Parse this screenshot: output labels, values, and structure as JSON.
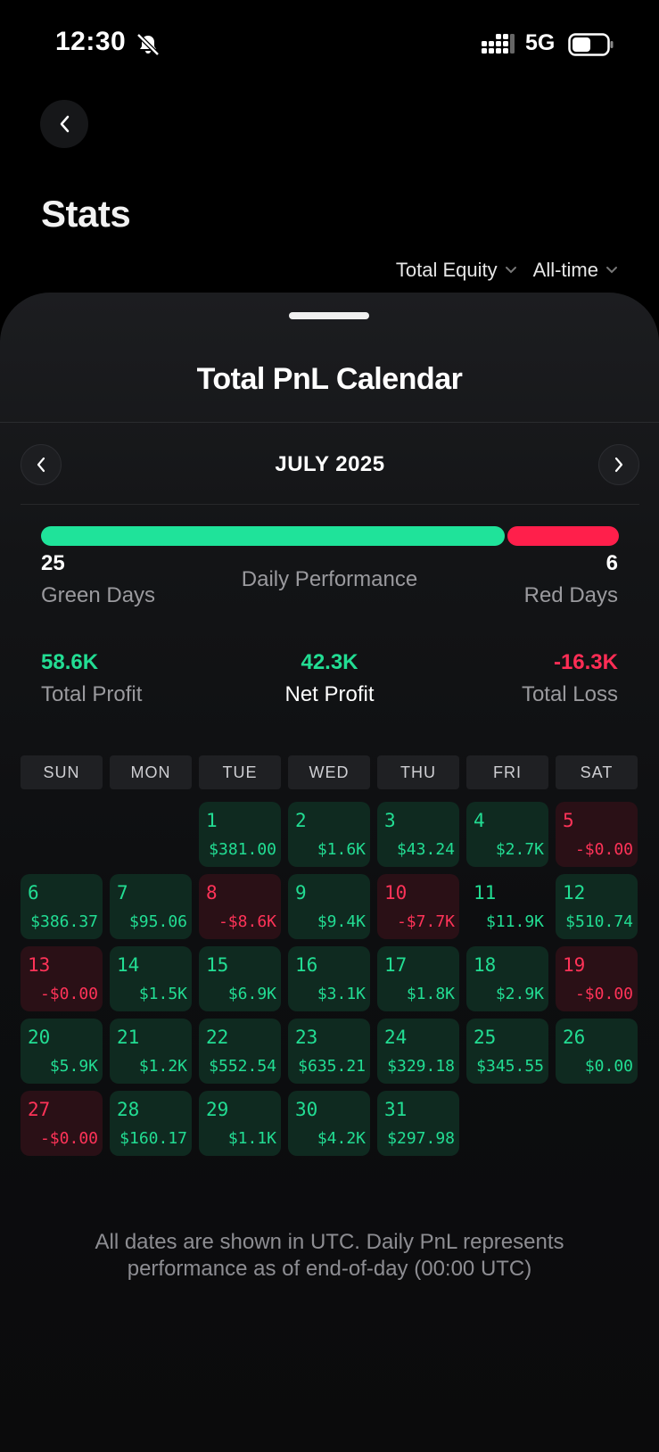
{
  "status_bar": {
    "time": "12:30",
    "network": "5G"
  },
  "header": {
    "title": "Stats"
  },
  "filters": [
    {
      "label": "Total Equity"
    },
    {
      "label": "All-time"
    }
  ],
  "calendar_sheet": {
    "title": "Total PnL Calendar",
    "month": "JULY 2025",
    "performance": {
      "green_count": "25",
      "green_label": "Green Days",
      "center_label": "Daily Performance",
      "red_count": "6",
      "red_label": "Red Days",
      "green_fraction": 0.8065
    },
    "totals": {
      "profit_value": "58.6K",
      "profit_label": "Total Profit",
      "net_value": "42.3K",
      "net_label": "Net Profit",
      "loss_value": "-16.3K",
      "loss_label": "Total Loss"
    },
    "weekdays": [
      "SUN",
      "MON",
      "TUE",
      "WED",
      "THU",
      "FRI",
      "SAT"
    ],
    "leading_blanks": 2,
    "days": [
      {
        "day": "1",
        "value": "$381.00",
        "status": "green"
      },
      {
        "day": "2",
        "value": "$1.6K",
        "status": "green"
      },
      {
        "day": "3",
        "value": "$43.24",
        "status": "green"
      },
      {
        "day": "4",
        "value": "$2.7K",
        "status": "green"
      },
      {
        "day": "5",
        "value": "-$0.00",
        "status": "red"
      },
      {
        "day": "6",
        "value": "$386.37",
        "status": "green"
      },
      {
        "day": "7",
        "value": "$95.06",
        "status": "green"
      },
      {
        "day": "8",
        "value": "-$8.6K",
        "status": "red"
      },
      {
        "day": "9",
        "value": "$9.4K",
        "status": "green"
      },
      {
        "day": "10",
        "value": "-$7.7K",
        "status": "red"
      },
      {
        "day": "11",
        "value": "$11.9K",
        "status": "neutral"
      },
      {
        "day": "12",
        "value": "$510.74",
        "status": "green"
      },
      {
        "day": "13",
        "value": "-$0.00",
        "status": "red"
      },
      {
        "day": "14",
        "value": "$1.5K",
        "status": "green"
      },
      {
        "day": "15",
        "value": "$6.9K",
        "status": "green"
      },
      {
        "day": "16",
        "value": "$3.1K",
        "status": "green"
      },
      {
        "day": "17",
        "value": "$1.8K",
        "status": "green"
      },
      {
        "day": "18",
        "value": "$2.9K",
        "status": "green"
      },
      {
        "day": "19",
        "value": "-$0.00",
        "status": "red"
      },
      {
        "day": "20",
        "value": "$5.9K",
        "status": "green"
      },
      {
        "day": "21",
        "value": "$1.2K",
        "status": "green"
      },
      {
        "day": "22",
        "value": "$552.54",
        "status": "green"
      },
      {
        "day": "23",
        "value": "$635.21",
        "status": "green"
      },
      {
        "day": "24",
        "value": "$329.18",
        "status": "green"
      },
      {
        "day": "25",
        "value": "$345.55",
        "status": "green"
      },
      {
        "day": "26",
        "value": "$0.00",
        "status": "green"
      },
      {
        "day": "27",
        "value": "-$0.00",
        "status": "red"
      },
      {
        "day": "28",
        "value": "$160.17",
        "status": "green"
      },
      {
        "day": "29",
        "value": "$1.1K",
        "status": "green"
      },
      {
        "day": "30",
        "value": "$4.2K",
        "status": "green"
      },
      {
        "day": "31",
        "value": "$297.98",
        "status": "green"
      }
    ],
    "footnote": "All dates are shown in UTC. Daily PnL represents performance as of end-of-day (00:00 UTC)"
  },
  "colors": {
    "green": "#1fe39a",
    "red": "#ff1f4b",
    "background": "#000000"
  },
  "icons": [
    "bell-off-icon",
    "signal-icon",
    "battery-icon",
    "chevron-left-icon",
    "chevron-right-icon",
    "chevron-down-icon"
  ]
}
